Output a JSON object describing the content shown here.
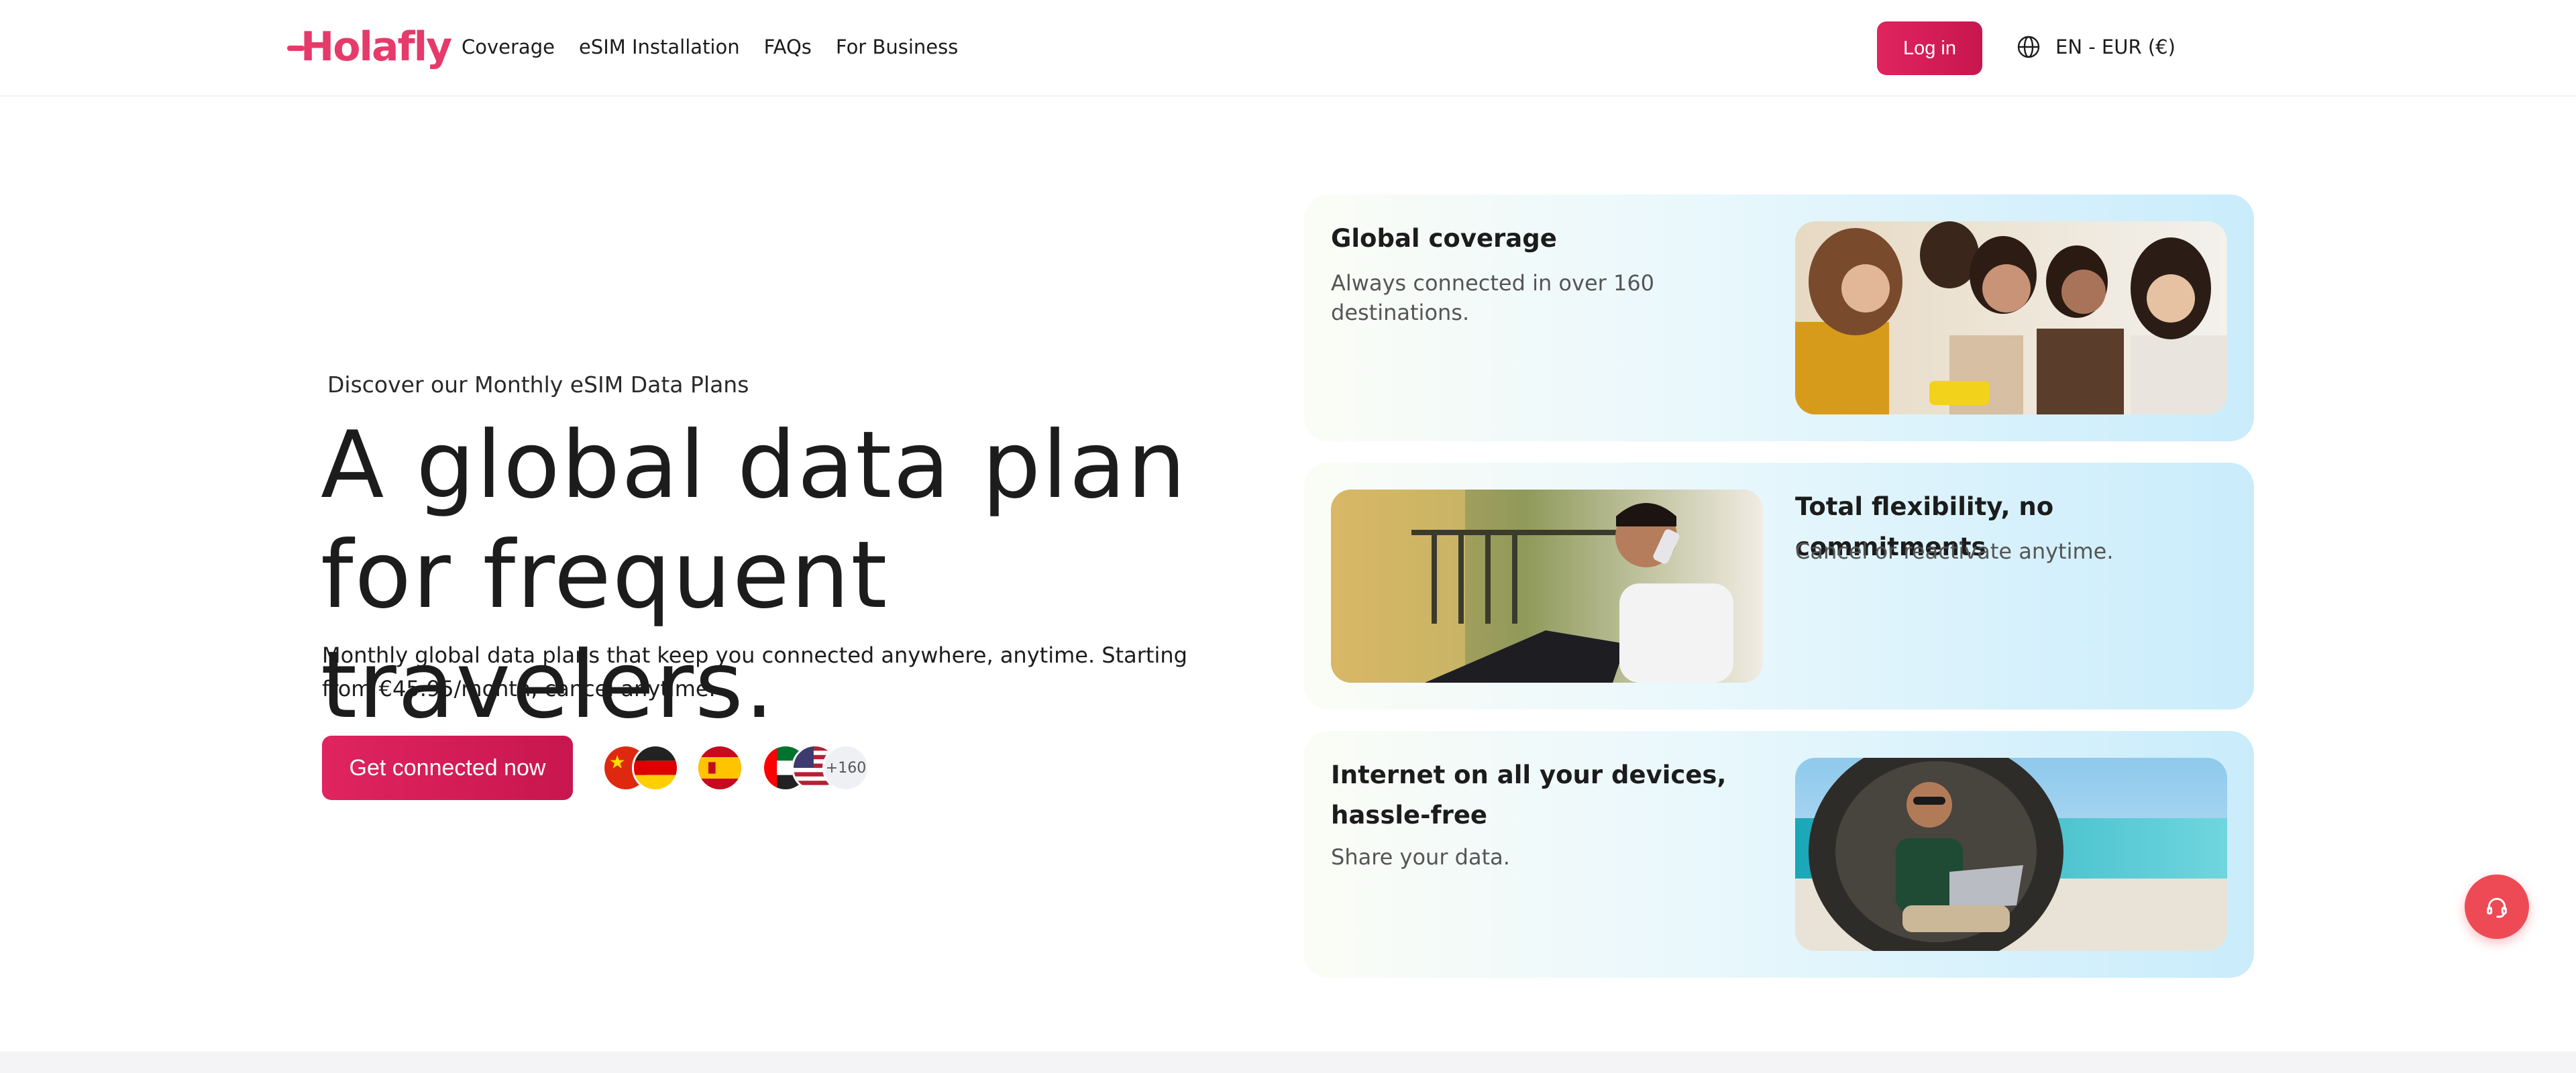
{
  "header": {
    "logo_text": "Holafly",
    "nav": [
      "Coverage",
      "eSIM Installation",
      "FAQs",
      "For Business"
    ],
    "login_label": "Log in",
    "language_label": "EN - EUR (€)"
  },
  "hero": {
    "eyebrow": "Discover our Monthly eSIM Data Plans",
    "headline": "A global data plan for frequent travelers.",
    "subtext": "Monthly global data plans that keep you connected anywhere, anytime. Starting from €45.95/month, cancel anytime.",
    "cta_label": "Get connected now",
    "flags_more": "+160",
    "flag_icons": [
      "china-flag-icon",
      "germany-flag-icon",
      "spain-flag-icon",
      "uae-flag-icon",
      "usa-flag-icon"
    ]
  },
  "features": [
    {
      "title": "Global coverage",
      "description": "Always connected in over 160 destinations.",
      "image": "group-of-friends-photo"
    },
    {
      "title": "Total flexibility, no commitments",
      "description": "Cancel or reactivate anytime.",
      "image": "man-on-phone-photo"
    },
    {
      "title": "Internet on all your devices, hassle-free",
      "description": "Share your data.",
      "image": "man-with-laptop-on-beach-photo"
    }
  ],
  "support_icon": "headset-icon",
  "colors": {
    "brand": "#e63a6b",
    "cta": "#d81e5b",
    "support": "#ee4a55"
  }
}
